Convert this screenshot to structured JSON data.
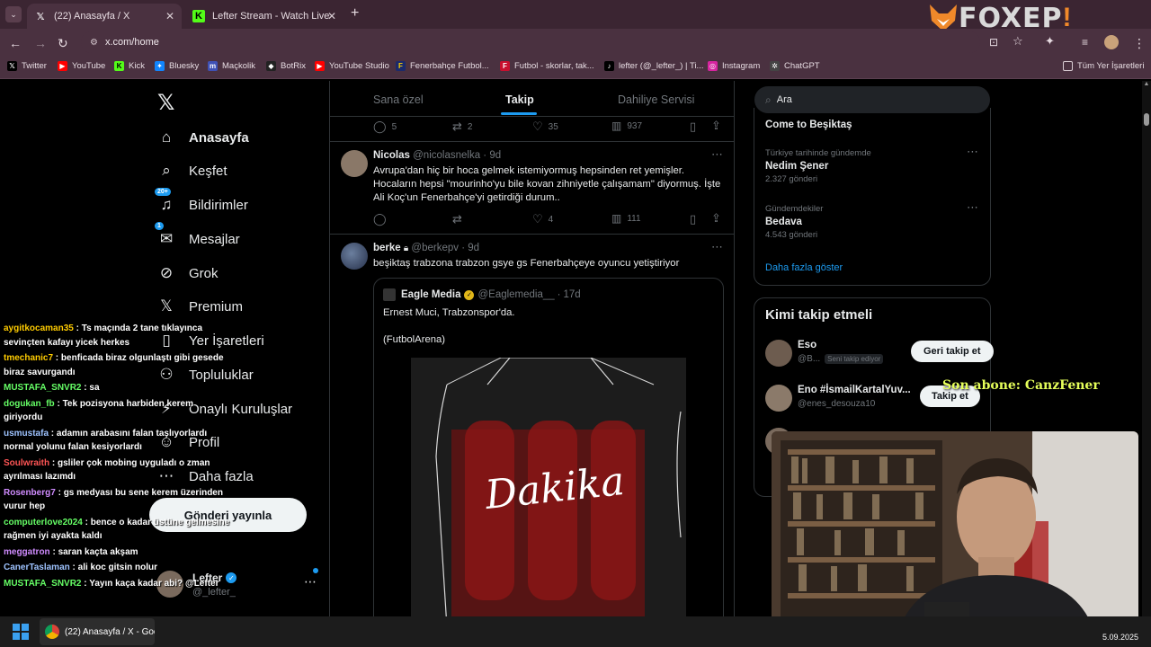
{
  "browser": {
    "tabs": [
      {
        "label": "(22) Anasayfa / X",
        "favicon": "X",
        "active": true
      },
      {
        "label": "Lefter Stream - Watch Live on K",
        "favicon": "K",
        "active": false
      }
    ],
    "url": "x.com/home",
    "bookmarks": [
      "Twitter",
      "YouTube",
      "Kick",
      "Bluesky",
      "Maçkolik",
      "BotRix",
      "YouTube Studio",
      "Fenerbahçe Futbol...",
      "Futbol - skorlar, tak...",
      "lefter (@_lefter_) | Ti...",
      "Instagram",
      "ChatGPT"
    ],
    "all_bookmarks": "Tüm Yer İşaretleri"
  },
  "overlay": {
    "logo": "FOXEP",
    "subscriber_text": "Son abone: CanzFener"
  },
  "sidebar": {
    "items": [
      {
        "label": "Anasayfa",
        "icon": "home-icon",
        "glyph": "⌂"
      },
      {
        "label": "Keşfet",
        "icon": "search-icon",
        "glyph": "⌕"
      },
      {
        "label": "Bildirimler",
        "icon": "bell-icon",
        "glyph": "♫",
        "badge": "20+"
      },
      {
        "label": "Mesajlar",
        "icon": "mail-icon",
        "glyph": "✉",
        "badge": "1"
      },
      {
        "label": "Grok",
        "icon": "grok-icon",
        "glyph": "⊘"
      },
      {
        "label": "Premium",
        "icon": "x-logo-icon",
        "glyph": "𝕏"
      },
      {
        "label": "Yer İşaretleri",
        "icon": "bookmark-icon",
        "glyph": "▯"
      },
      {
        "label": "Topluluklar",
        "icon": "communities-icon",
        "glyph": "⚇"
      },
      {
        "label": "Onaylı Kuruluşlar",
        "icon": "verified-org-icon",
        "glyph": "⚡"
      },
      {
        "label": "Profil",
        "icon": "profile-icon",
        "glyph": "☺"
      },
      {
        "label": "Daha fazla",
        "icon": "more-icon",
        "glyph": "⋯"
      }
    ],
    "post_button": "Gönderi yayınla",
    "account_name": "Lefter",
    "account_handle": "@_lefter_"
  },
  "timeline": {
    "tabs": [
      "Sana özel",
      "Takip",
      "Dahiliye Servisi"
    ],
    "prev_actions": {
      "replies": "5",
      "reposts": "2",
      "likes": "35",
      "views": "937"
    },
    "tweets": [
      {
        "name": "Nicolas",
        "handle": "@nicolasnelka",
        "time": "9d",
        "text": "Avrupa'dan hiç bir hoca gelmek istemiyormuş hepsinden ret yemişler. Hocaların hepsi \"mourinho'yu bile kovan zihniyetle çalışamam\" diyormuş. İşte Ali Koç'un Fenerbahçe'yi getirdiği durum..",
        "replies": "",
        "reposts": "",
        "likes": "4",
        "views": "111"
      },
      {
        "name": "berke",
        "handle": "@berkepv",
        "time": "9d",
        "text": "beşiktaş trabzona trabzon gsye gs Fenerbahçeye oyuncu yetiştiriyor",
        "quote": {
          "name": "Eagle Media",
          "handle": "@Eaglemedia__",
          "time": "17d",
          "line1": "Ernest Muci, Trabzonspor'da.",
          "line2": "(FutbolArena)",
          "image_text": "Dakika"
        }
      }
    ]
  },
  "right": {
    "search_placeholder": "Ara",
    "trends": [
      {
        "context": "",
        "title": "Come to Beşiktaş",
        "count": ""
      },
      {
        "context": "Türkiye tarihinde gündemde",
        "title": "Nedim Şener",
        "count": "2.327 gönderi"
      },
      {
        "context": "Gündemdekiler",
        "title": "Bedava",
        "count": "4.543 gönderi"
      }
    ],
    "show_more": "Daha fazla göster",
    "who_to_follow_title": "Kimi takip etmeli",
    "follow": [
      {
        "name": "Eso",
        "handle": "@B...",
        "follows_you": "Seni takip ediyor",
        "button": "Geri takip et"
      },
      {
        "name": "Eno #İsmailKartalYuv...",
        "handle": "@enes_desouza10",
        "button": "Takip et"
      }
    ]
  },
  "chat": [
    {
      "user": "aygitkocaman35",
      "color": "#ffcc00",
      "msg": "Ts maçında 2 tane tıklayınca sevinçten kafayı yicek herkes"
    },
    {
      "user": "tmechanic7",
      "color": "#ffcc00",
      "msg": "benficada biraz olgunlaştı gibi gesede biraz savurgandı"
    },
    {
      "user": "MUSTAFA_SNVR2",
      "color": "#66ff66",
      "msg": "sa"
    },
    {
      "user": "dogukan_fb",
      "color": "#66ff66",
      "msg": "Tek pozisyona harbiden kerem giriyordu"
    },
    {
      "user": "usmustafa",
      "color": "#9ec3ff",
      "msg": "adamın arabasını falan taşlıyorlardı normal yolunu falan kesiyorlardı"
    },
    {
      "user": "Soulwraith",
      "color": "#ff5555",
      "msg": "gsliler çok mobing uyguladı o zman ayrılması lazımdı"
    },
    {
      "user": "Rosenberg7",
      "color": "#d08cff",
      "msg": "gs medyası bu sene kerem üzerinden vurur hep"
    },
    {
      "user": "computerlove2024",
      "color": "#66ff66",
      "msg": "bence o kadar üstüne gelmesine rağmen iyi ayakta kaldı"
    },
    {
      "user": "meggatron",
      "color": "#d08cff",
      "msg": "saran kaçta akşam"
    },
    {
      "user": "CanerTaslaman",
      "color": "#9ec3ff",
      "msg": "ali koc gitsin nolur"
    },
    {
      "user": "MUSTAFA_SNVR2",
      "color": "#66ff66",
      "msg": "Yayın kaça kadar abi? @Lefter"
    }
  ],
  "taskbar": {
    "app_label": "(22) Anasayfa / X - Goo",
    "date": "5.09.2025"
  },
  "colors": {
    "accent": "#1d9bf0",
    "tab_bg": "#3b2532",
    "chrome_bg": "#4a3140"
  }
}
